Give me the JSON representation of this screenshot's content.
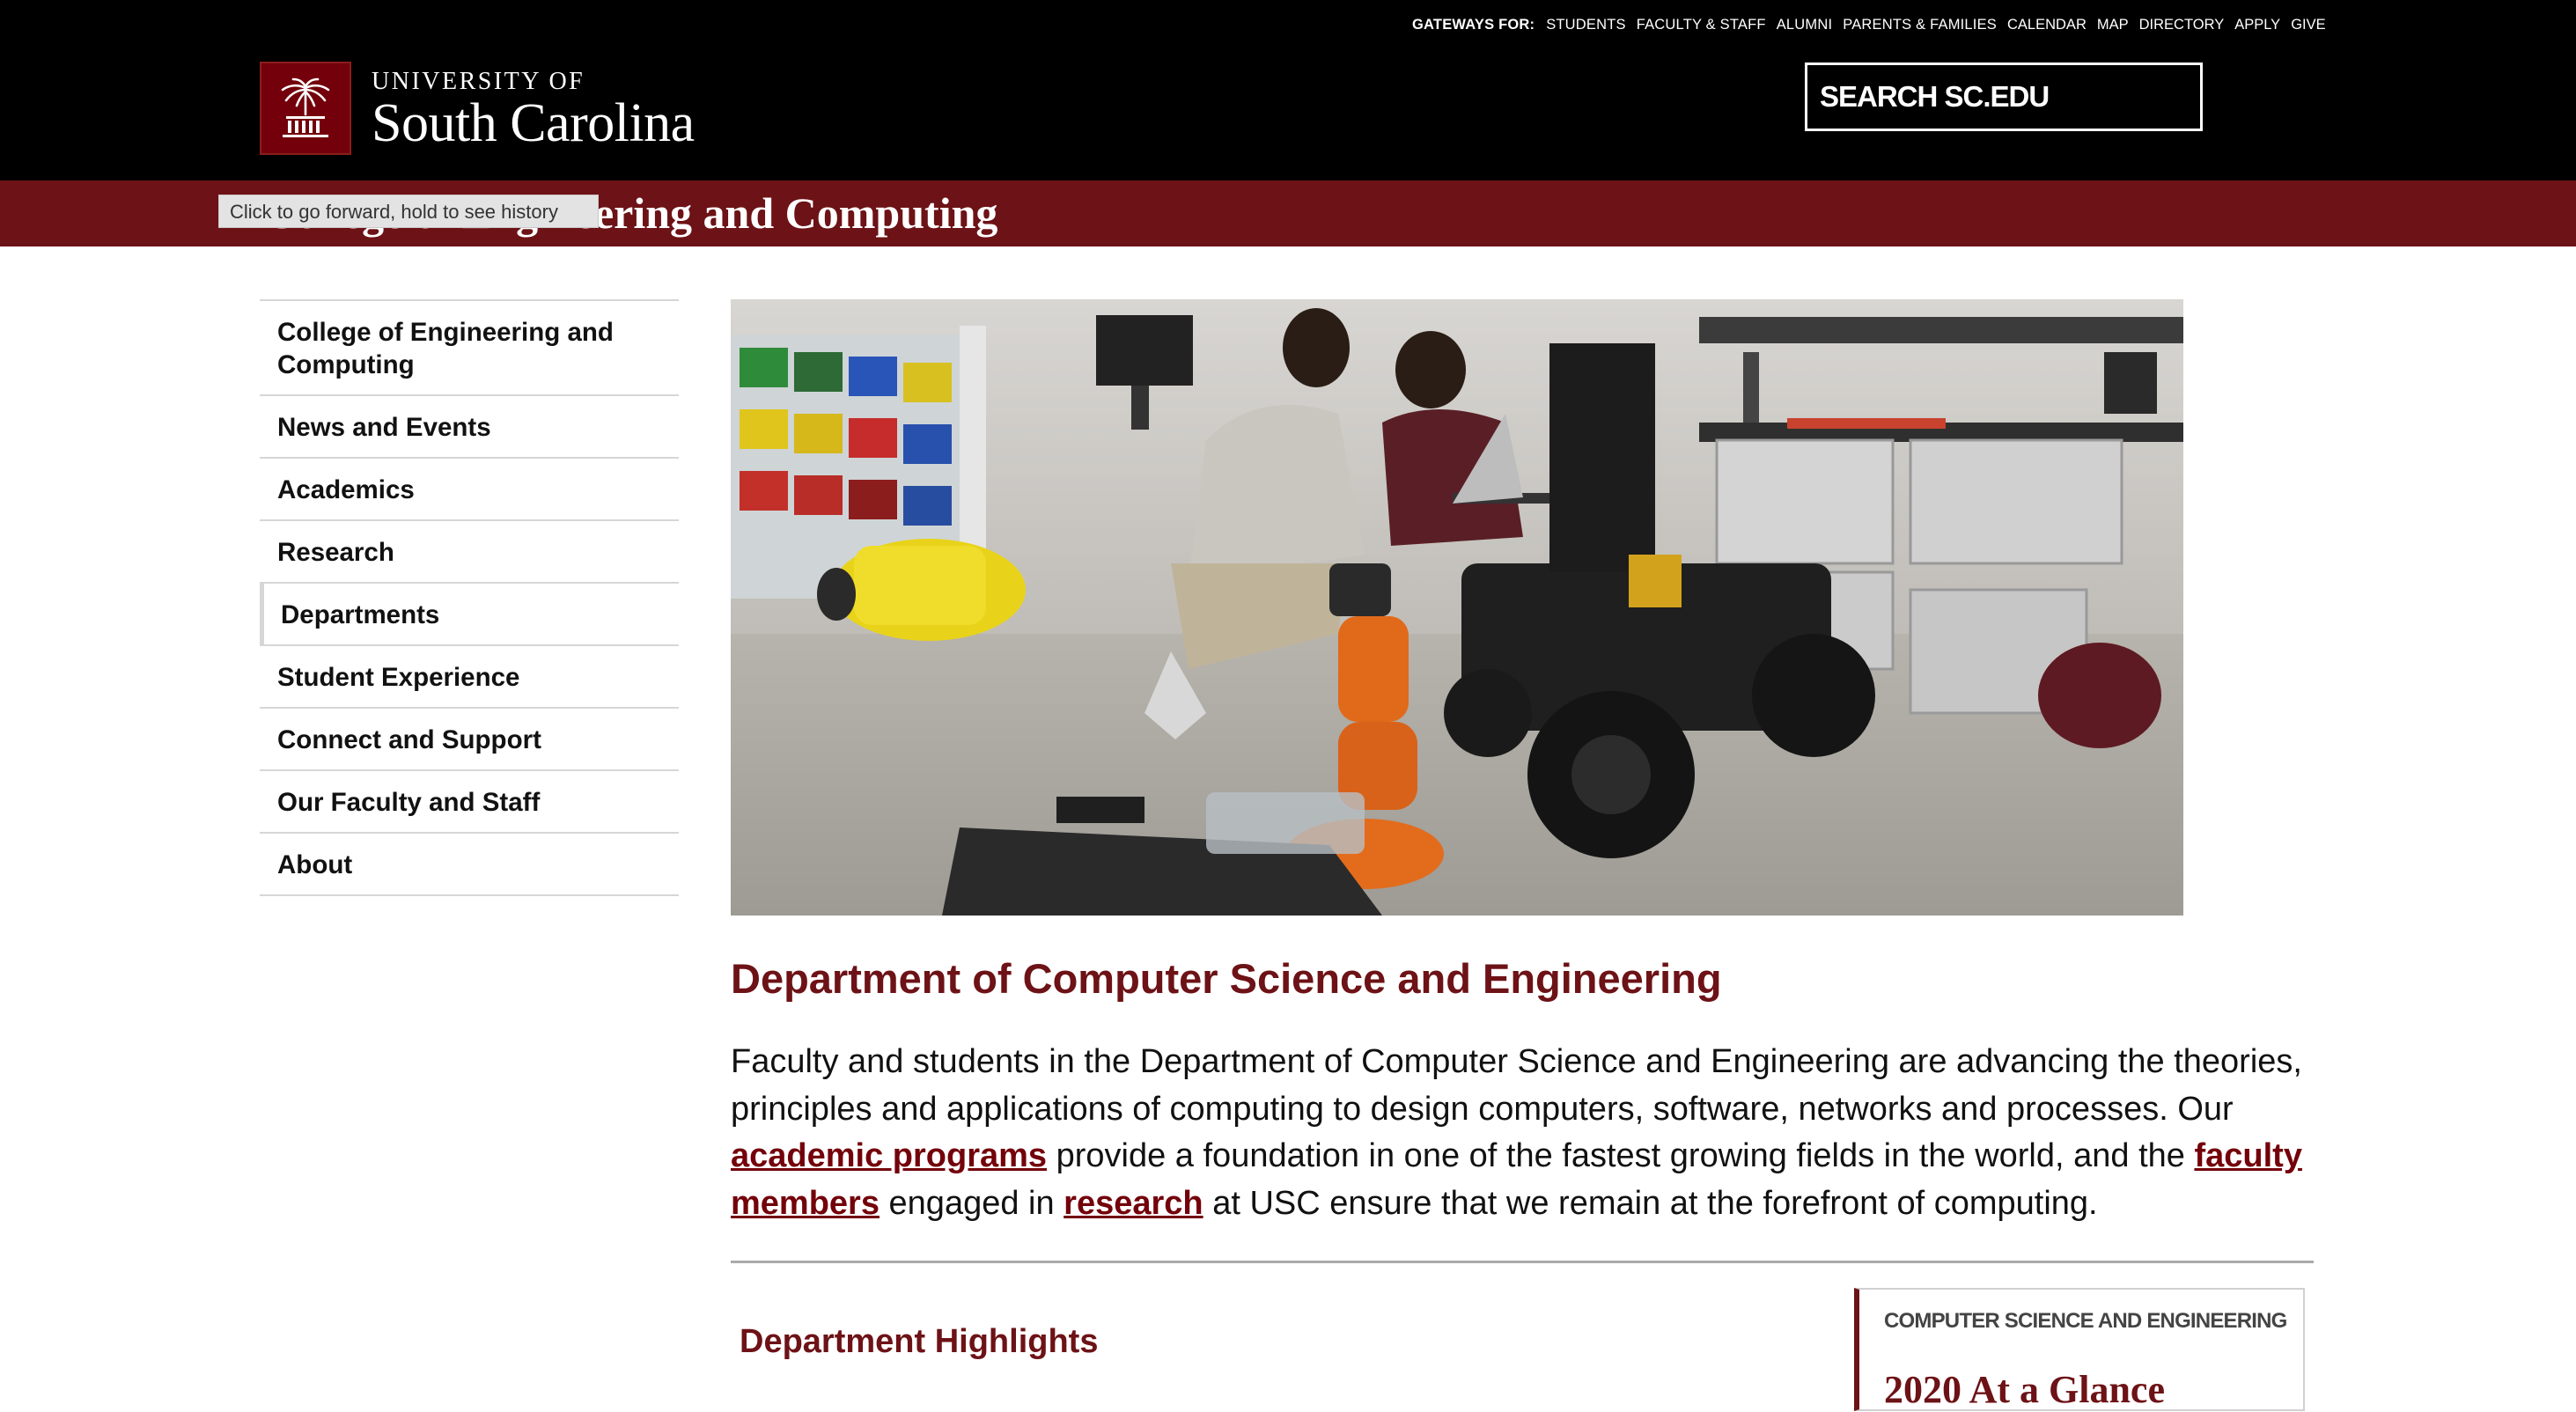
{
  "header": {
    "gateways_label": "GATEWAYS FOR:",
    "gateways": [
      "STUDENTS",
      "FACULTY & STAFF",
      "ALUMNI",
      "PARENTS & FAMILIES"
    ],
    "utility_links": [
      "CALENDAR",
      "MAP",
      "DIRECTORY",
      "APPLY",
      "GIVE"
    ],
    "logo_line1": "UNIVERSITY OF",
    "logo_line2": "South Carolina",
    "search_placeholder": "SEARCH SC.EDU"
  },
  "college_title": "College of Engineering and Computing",
  "tooltip": "Click to go forward, hold to see history",
  "sidebar": {
    "items": [
      {
        "label": "College of Engineering and Computing"
      },
      {
        "label": "News and Events"
      },
      {
        "label": "Academics"
      },
      {
        "label": "Research"
      },
      {
        "label": "Departments"
      },
      {
        "label": "Student Experience"
      },
      {
        "label": "Connect and Support"
      },
      {
        "label": "Our Faculty and Staff"
      },
      {
        "label": "About"
      }
    ]
  },
  "main": {
    "title": "Department of Computer Science and Engineering",
    "intro_1": "Faculty and students in the Department of Computer Science and Engineering are advancing the theories, principles and applications of computing to design computers, software, networks and processes. Our ",
    "link_programs": "academic programs",
    "intro_2": " provide a foundation in one of the fastest growing fields in the world, and the ",
    "link_faculty": "faculty members",
    "intro_3": " engaged in ",
    "link_research": "research",
    "intro_4": " at USC ensure that we remain at the forefront of computing.",
    "highlights_title": "Department Highlights"
  },
  "glance_card": {
    "kicker": "COMPUTER SCIENCE AND ENGINEERING",
    "title": "2020 At a Glance"
  },
  "colors": {
    "garnet": "#73000a",
    "band": "#6d1216",
    "header_bg": "#000000"
  }
}
